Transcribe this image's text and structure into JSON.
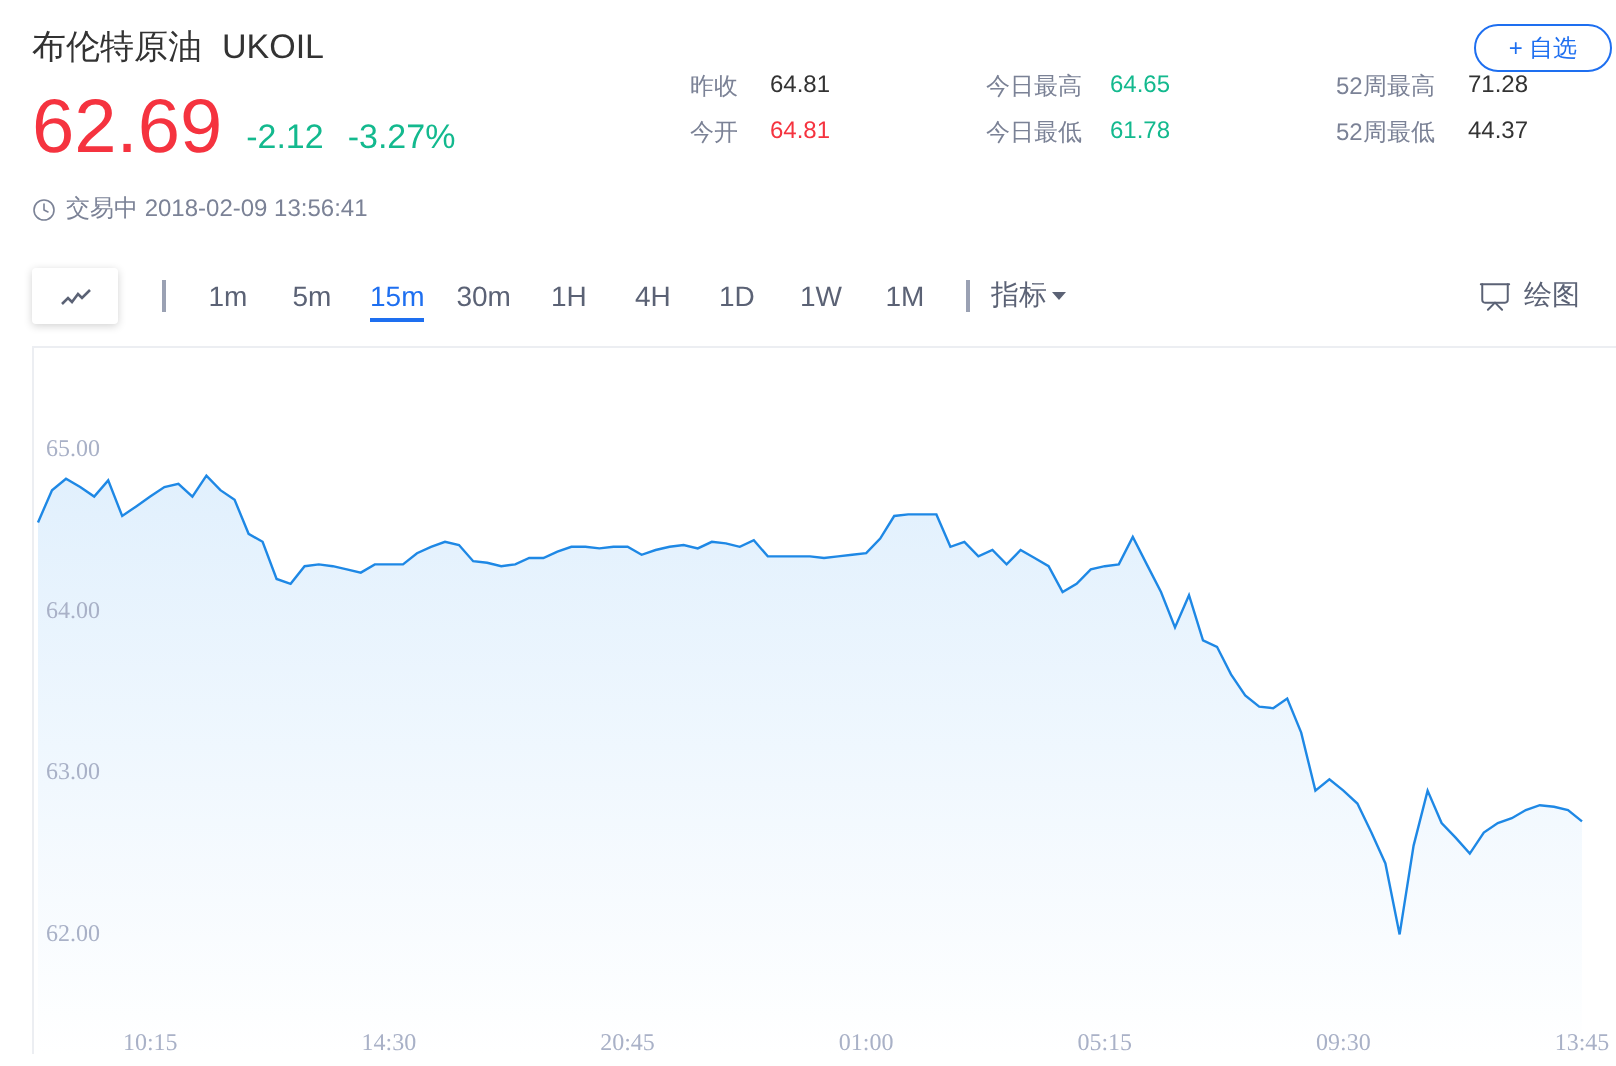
{
  "header": {
    "title": "布伦特原油",
    "symbol": "UKOIL",
    "watch_button": "+ 自选"
  },
  "quote": {
    "price": "62.69",
    "change": "-2.12",
    "change_percent": "-3.27%"
  },
  "stats": [
    {
      "label": "昨收",
      "value": "64.81",
      "color": "#333333"
    },
    {
      "label": "今日最高",
      "value": "64.65",
      "color": "#13b98e"
    },
    {
      "label": "52周最高",
      "value": "71.28",
      "color": "#333333"
    },
    {
      "label": "今开",
      "value": "64.81",
      "color": "#f5333f"
    },
    {
      "label": "今日最低",
      "value": "61.78",
      "color": "#13b98e"
    },
    {
      "label": "52周最低",
      "value": "44.37",
      "color": "#333333"
    }
  ],
  "status": {
    "text": "交易中 2018-02-09 13:56:41"
  },
  "toolbar": {
    "intervals": [
      {
        "label": "1m",
        "selected": false
      },
      {
        "label": "5m",
        "selected": false
      },
      {
        "label": "15m",
        "selected": true
      },
      {
        "label": "30m",
        "selected": false
      },
      {
        "label": "1H",
        "selected": false
      },
      {
        "label": "4H",
        "selected": false
      },
      {
        "label": "1D",
        "selected": false
      },
      {
        "label": "1W",
        "selected": false
      },
      {
        "label": "1M",
        "selected": false
      }
    ],
    "indicators_menu": "指标",
    "draw_button": "绘图"
  },
  "chart": {
    "chart_data": {
      "type": "area",
      "ylim": [
        61.25,
        65.62
      ],
      "yticks": [
        {
          "value": 62,
          "label": "62.00"
        },
        {
          "value": 63,
          "label": "63.00"
        },
        {
          "value": 64,
          "label": "64.00"
        },
        {
          "value": 65,
          "label": "65.00"
        }
      ],
      "categories": [
        null,
        null,
        null,
        null,
        null,
        null,
        null,
        null,
        "10:15",
        null,
        null,
        null,
        null,
        null,
        null,
        null,
        null,
        null,
        null,
        null,
        null,
        null,
        null,
        null,
        null,
        "14:30",
        null,
        null,
        null,
        null,
        null,
        null,
        null,
        null,
        null,
        null,
        null,
        null,
        null,
        null,
        null,
        null,
        "20:45",
        null,
        null,
        null,
        null,
        null,
        null,
        null,
        null,
        null,
        null,
        null,
        null,
        null,
        null,
        null,
        null,
        "01:00",
        null,
        null,
        null,
        null,
        null,
        null,
        null,
        null,
        null,
        null,
        null,
        null,
        null,
        null,
        null,
        null,
        "05:15",
        null,
        null,
        null,
        null,
        null,
        null,
        null,
        null,
        null,
        null,
        null,
        null,
        null,
        null,
        null,
        null,
        "09:30",
        null,
        null,
        null,
        null,
        null,
        null,
        null,
        null,
        null,
        null,
        null,
        null,
        null,
        null,
        null,
        null,
        "13:45"
      ],
      "series": [
        {
          "color": "#1e88e5",
          "values": [
            64.54,
            64.74,
            64.81,
            64.76,
            64.7,
            64.8,
            64.58,
            64.64,
            64.7,
            64.76,
            64.78,
            64.7,
            64.83,
            64.74,
            64.68,
            64.47,
            64.42,
            64.19,
            64.16,
            64.27,
            64.28,
            64.27,
            64.25,
            64.23,
            64.28,
            64.28,
            64.28,
            64.35,
            64.39,
            64.42,
            64.4,
            64.3,
            64.29,
            64.27,
            64.28,
            64.32,
            64.32,
            64.36,
            64.39,
            64.39,
            64.38,
            64.39,
            64.39,
            64.34,
            64.37,
            64.39,
            64.4,
            64.38,
            64.42,
            64.41,
            64.39,
            64.43,
            64.33,
            64.33,
            64.33,
            64.33,
            64.32,
            64.33,
            64.34,
            64.35,
            64.44,
            64.58,
            64.59,
            64.59,
            64.59,
            64.39,
            64.42,
            64.33,
            64.37,
            64.28,
            64.37,
            64.32,
            64.27,
            64.11,
            64.16,
            64.25,
            64.27,
            64.28,
            64.45,
            64.28,
            64.11,
            63.89,
            64.09,
            63.81,
            63.77,
            63.6,
            63.47,
            63.4,
            63.39,
            63.45,
            63.24,
            62.88,
            62.95,
            62.88,
            62.8,
            62.62,
            62.43,
            61.99,
            62.54,
            62.88,
            62.68,
            62.59,
            62.49,
            62.62,
            62.68,
            62.71,
            62.76,
            62.79,
            62.78,
            62.76,
            62.69
          ]
        }
      ]
    }
  }
}
